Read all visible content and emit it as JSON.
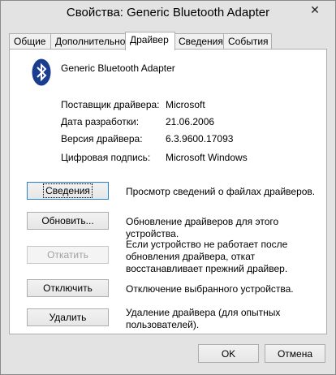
{
  "window": {
    "title": "Свойства: Generic Bluetooth Adapter",
    "close_glyph": "✕"
  },
  "tabs": [
    {
      "label": "Общие"
    },
    {
      "label": "Дополнительно"
    },
    {
      "label": "Драйвер",
      "active": true
    },
    {
      "label": "Сведения"
    },
    {
      "label": "События"
    }
  ],
  "device": {
    "name": "Generic Bluetooth Adapter",
    "icon": "bluetooth-icon",
    "icon_color": "#1a3d8f"
  },
  "info": [
    {
      "label": "Поставщик драйвера:",
      "value": "Microsoft"
    },
    {
      "label": "Дата разработки:",
      "value": "21.06.2006"
    },
    {
      "label": "Версия драйвера:",
      "value": "6.3.9600.17093"
    },
    {
      "label": "Цифровая подпись:",
      "value": "Microsoft Windows"
    }
  ],
  "actions": [
    {
      "label": "Сведения",
      "desc": "Просмотр сведений о файлах драйверов.",
      "enabled": true,
      "focused": true
    },
    {
      "label": "Обновить...",
      "desc": "Обновление драйверов для этого устройства.",
      "enabled": true
    },
    {
      "label": "Откатить",
      "desc": "Если устройство не работает после обновления драйвера, откат восстанавливает прежний драйвер.",
      "enabled": false
    },
    {
      "label": "Отключить",
      "desc": "Отключение выбранного устройства.",
      "enabled": true
    },
    {
      "label": "Удалить",
      "desc": "Удаление драйвера (для опытных пользователей).",
      "enabled": true
    }
  ],
  "footer": {
    "ok_label": "OK",
    "cancel_label": "Отмена"
  }
}
